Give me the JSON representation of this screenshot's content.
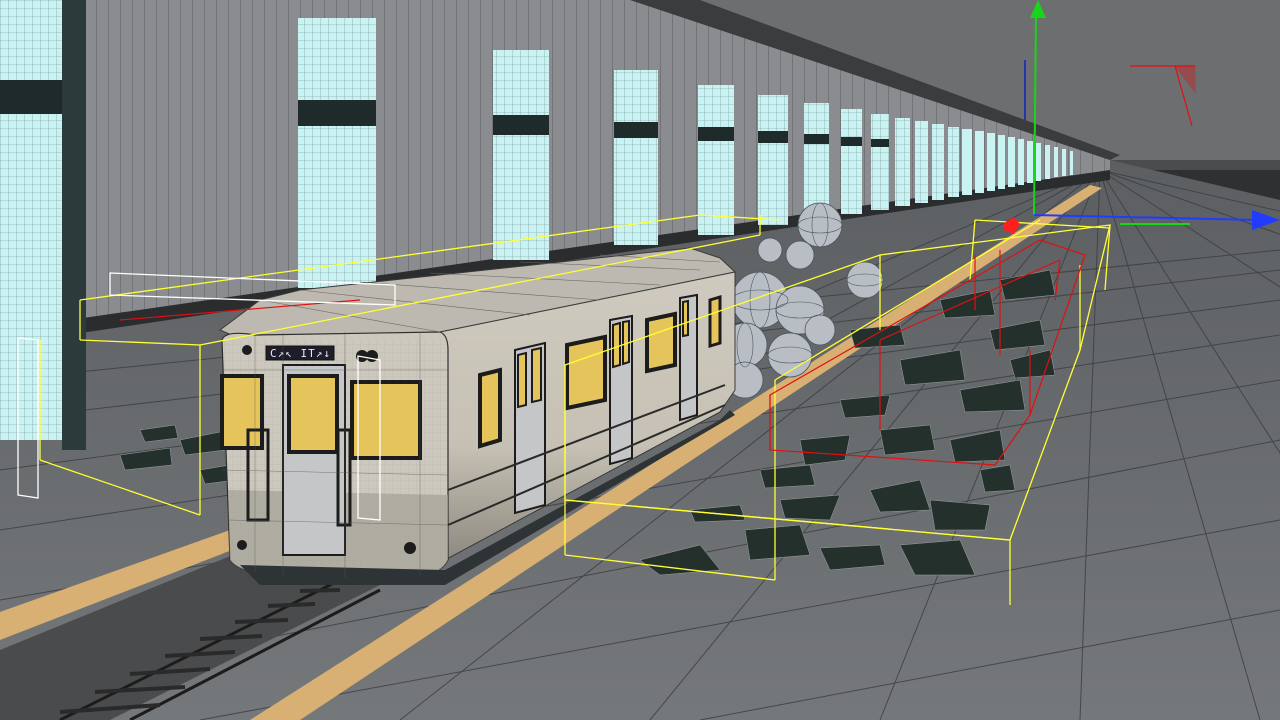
{
  "viewport": {
    "mode": "perspective-wireframe-shaded",
    "train": {
      "destination_sign": "C↗↖ IT↗↓"
    },
    "gizmo": {
      "axis_colors": {
        "x": "#1f3cff",
        "y": "#17d617",
        "z": "#1020c0"
      },
      "pivot_color": "#ff1f1f"
    },
    "colors": {
      "sky": "#6d6f70",
      "wall": "#8a8c8f",
      "window_glass": "#c9f2f3",
      "platform": "#6c6f72",
      "safety_stripe": "#d9b074",
      "train_body": "#c9c4b8",
      "train_window": "#e6c45c",
      "bbox_yellow": "#ffff33",
      "bbox_red": "#e01010",
      "debris": "#24302c",
      "grid_line": "#3a3c3e"
    }
  }
}
